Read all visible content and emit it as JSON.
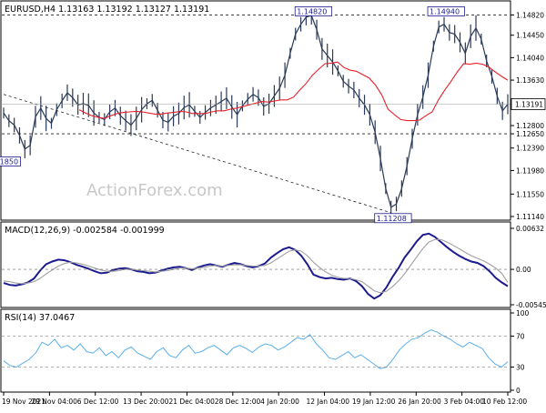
{
  "header": {
    "symbol_info": "EURUSD,H4  1.13163 1.13192 1.13127 1.13191",
    "watermark": "ActionForex.com"
  },
  "colors": {
    "price_bars": "#2b3a57",
    "sma": "#e8202a",
    "macd_line": "#1b1b8f",
    "macd_signal": "#a0a0a0",
    "rsi": "#5aaee8",
    "dotted": "#222222",
    "label_border": "#1b1b8f"
  },
  "chart_data": [
    {
      "type": "line",
      "name": "price",
      "ylim": [
        1.1114,
        1.1496
      ],
      "y_ticks": [
        "1.14820",
        "1.14450",
        "1.14040",
        "1.13630",
        "1.13191",
        "1.12800",
        "1.12650",
        "1.12390",
        "1.11980",
        "1.11550",
        "1.11140"
      ],
      "y_tick_values": [
        1.1482,
        1.1445,
        1.1404,
        1.1363,
        1.13191,
        1.128,
        1.1265,
        1.1239,
        1.1198,
        1.1155,
        1.1114
      ],
      "x_tick_labels": [
        "19 Nov 2021",
        "29 Nov 04:00",
        "6 Dec 12:00",
        "13 Dec 20:00",
        "21 Dec 04:00",
        "28 Dec 12:00",
        "4 Jan 20:00",
        "12 Jan 04:00",
        "19 Jan 12:00",
        "26 Jan 20:00",
        "3 Feb 04:00",
        "10 Feb 12:00"
      ],
      "series": [
        {
          "values": [
            1.1303,
            1.1289,
            1.1281,
            1.1262,
            1.1237,
            1.1244,
            1.1296,
            1.1312,
            1.1293,
            1.1284,
            1.1309,
            1.1325,
            1.134,
            1.1331,
            1.1318,
            1.132,
            1.1317,
            1.1303,
            1.1295,
            1.1291,
            1.1305,
            1.1312,
            1.1298,
            1.1289,
            1.1281,
            1.1293,
            1.1309,
            1.132,
            1.1326,
            1.1308,
            1.129,
            1.1286,
            1.1297,
            1.1302,
            1.1313,
            1.1318,
            1.1306,
            1.1295,
            1.1304,
            1.1312,
            1.1318,
            1.1324,
            1.133,
            1.1314,
            1.13,
            1.1316,
            1.1328,
            1.1337,
            1.1331,
            1.1315,
            1.132,
            1.1334,
            1.1348,
            1.1372,
            1.1412,
            1.1447,
            1.1465,
            1.1478,
            1.1481,
            1.1455,
            1.142,
            1.1408,
            1.1396,
            1.138,
            1.1361,
            1.1352,
            1.1345,
            1.133,
            1.1318,
            1.13,
            1.1268,
            1.122,
            1.1165,
            1.1131,
            1.1137,
            1.1165,
            1.1206,
            1.1256,
            1.13,
            1.1332,
            1.1372,
            1.1425,
            1.146,
            1.1465,
            1.145,
            1.1447,
            1.1432,
            1.1412,
            1.1443,
            1.1458,
            1.1438,
            1.1398,
            1.137,
            1.1334,
            1.1307,
            1.1319
          ]
        },
        {
          "values": [
            null,
            null,
            null,
            null,
            null,
            null,
            null,
            null,
            null,
            null,
            null,
            null,
            1.1309,
            1.1303,
            1.1298,
            1.1295,
            1.1293,
            1.1298,
            1.1302,
            1.1304,
            1.1305,
            1.1306,
            1.1305,
            1.1303,
            1.1301,
            1.1301,
            1.1303,
            1.1304,
            1.1306,
            1.1305,
            1.1302,
            1.1302,
            1.1302,
            1.1305,
            1.1307,
            1.1307,
            1.131,
            1.1312,
            1.1315,
            1.1318,
            1.1321,
            1.1324,
            1.1323,
            1.1325,
            1.1327,
            1.1327,
            1.1332,
            1.1345,
            1.1357,
            1.1372,
            1.1383,
            1.1393,
            1.1394,
            1.1396,
            1.1386,
            1.1381,
            1.1379,
            1.1373,
            1.1367,
            1.1354,
            1.1336,
            1.131,
            1.13,
            1.1291,
            1.1289,
            1.1289,
            1.129,
            1.1298,
            1.1305,
            1.1327,
            1.1345,
            1.1361,
            1.1378,
            1.1393,
            1.1392,
            1.1394,
            1.1392,
            1.1387,
            1.1378,
            1.137,
            1.1363
          ]
        }
      ],
      "annotations": [
        {
          "text": "1.14820",
          "x_index": 58
        },
        {
          "text": "1.14940",
          "x_index": 83
        },
        {
          "text": "1.11208",
          "x_index": 73
        },
        {
          "text": "1850",
          "x_index": 2
        }
      ],
      "horizontal_lines": [
        1.1482,
        1.1265
      ],
      "trendline": {
        "from_index": 0,
        "from_value": 1.1337,
        "to_index": 73,
        "to_value": 1.1121
      },
      "current_price_label": "1.13191"
    },
    {
      "type": "line",
      "name": "MACD",
      "title": "MACD(12,26,9) -0.002584 -0.001999",
      "ylim": [
        -0.005455,
        0.00632
      ],
      "y_ticks": [
        "0.00632",
        "0.00",
        "-0.005455"
      ],
      "y_tick_values": [
        0.00632,
        0.0,
        -0.005455
      ],
      "series": [
        {
          "values": [
            -0.0021,
            -0.0024,
            -0.0025,
            -0.0023,
            -0.002,
            -0.0014,
            -0.0002,
            0.0008,
            0.0012,
            0.0015,
            0.0014,
            0.0011,
            0.0007,
            0.0004,
            0.0001,
            -0.0003,
            -0.0006,
            -0.0005,
            -0.0001,
            0.0001,
            0.0002,
            0.0,
            -0.0003,
            -0.0004,
            -0.0006,
            -0.0005,
            -0.0002,
            0.0001,
            0.0003,
            0.0004,
            0.0002,
            -0.0001,
            0.0003,
            0.0006,
            0.0008,
            0.0006,
            0.0004,
            0.0007,
            0.001,
            0.0008,
            0.0005,
            0.0003,
            0.0005,
            0.0009,
            0.0018,
            0.0025,
            0.0031,
            0.0034,
            0.003,
            0.0021,
            0.0008,
            -0.0008,
            -0.0012,
            -0.0014,
            -0.0013,
            -0.0015,
            -0.0016,
            -0.0014,
            -0.0018,
            -0.0026,
            -0.0038,
            -0.0045,
            -0.004,
            -0.0028,
            -0.0012,
            0.0002,
            0.0018,
            0.003,
            0.0043,
            0.0053,
            0.0055,
            0.005,
            0.0042,
            0.0034,
            0.0027,
            0.0021,
            0.0016,
            0.0012,
            0.001,
            0.0005,
            -0.0003,
            -0.0013,
            -0.002,
            -0.0026
          ]
        },
        {
          "values": [
            -0.0018,
            -0.0019,
            -0.0021,
            -0.0022,
            -0.0021,
            -0.0019,
            -0.0014,
            -0.0007,
            -0.0001,
            0.0005,
            0.0009,
            0.0011,
            0.001,
            0.0008,
            0.0005,
            0.0002,
            -0.0001,
            -0.0003,
            -0.0003,
            -0.0002,
            0.0,
            0.0,
            -0.0001,
            -0.0002,
            -0.0003,
            -0.0004,
            -0.0003,
            -0.0002,
            0.0,
            0.0002,
            0.0002,
            0.0001,
            0.0002,
            0.0003,
            0.0005,
            0.0006,
            0.0005,
            0.0006,
            0.0007,
            0.0007,
            0.0006,
            0.0005,
            0.0005,
            0.0006,
            0.001,
            0.0016,
            0.0022,
            0.0028,
            0.003,
            0.0028,
            0.0021,
            0.0011,
            0.0003,
            -0.0004,
            -0.0009,
            -0.0012,
            -0.0014,
            -0.0014,
            -0.0016,
            -0.0019,
            -0.0026,
            -0.0033,
            -0.0036,
            -0.0034,
            -0.0027,
            -0.0018,
            -0.0007,
            0.0006,
            0.0019,
            0.0032,
            0.0042,
            0.0046,
            0.0046,
            0.0042,
            0.0037,
            0.0032,
            0.0026,
            0.0021,
            0.0017,
            0.0013,
            0.0008,
            0.0002,
            -0.0006,
            -0.002
          ]
        }
      ]
    },
    {
      "type": "line",
      "name": "RSI",
      "title": "RSI(14) 37.0467",
      "ylim": [
        0,
        100
      ],
      "y_ticks": [
        "100",
        "70",
        "30",
        "0"
      ],
      "y_tick_values": [
        100,
        70,
        30,
        0
      ],
      "series": [
        {
          "values": [
            38,
            32,
            30,
            35,
            40,
            48,
            62,
            58,
            66,
            55,
            58,
            52,
            60,
            50,
            48,
            55,
            45,
            50,
            42,
            52,
            56,
            48,
            44,
            40,
            50,
            55,
            45,
            42,
            52,
            58,
            48,
            50,
            55,
            58,
            52,
            46,
            55,
            58,
            54,
            49,
            56,
            60,
            58,
            52,
            56,
            62,
            68,
            66,
            72,
            60,
            52,
            42,
            40,
            45,
            50,
            42,
            46,
            40,
            34,
            28,
            30,
            40,
            52,
            60,
            66,
            68,
            74,
            78,
            75,
            70,
            66,
            60,
            56,
            62,
            58,
            54,
            42,
            34,
            30,
            37
          ]
        }
      ]
    }
  ]
}
